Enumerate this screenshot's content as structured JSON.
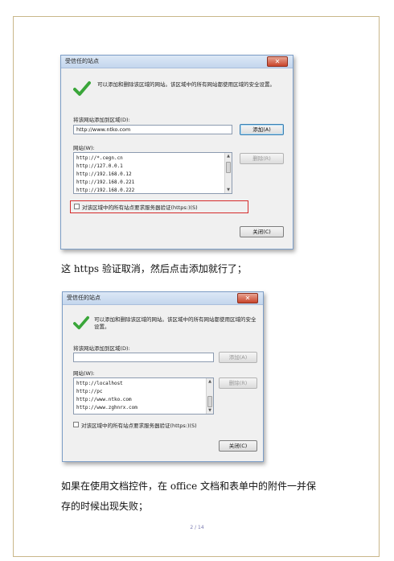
{
  "dialog1": {
    "title": "受信任的站点",
    "close": "✕",
    "description": "可以添加和删除该区域的网站。该区域中的所有网站都使用区域的安全设置。",
    "add_label": "将该网站添加到区域(D):",
    "add_value": "http://www.ntko.com",
    "add_button": "添加(A)",
    "sites_label": "网站(W):",
    "sites": [
      "http://*.cegn.cn",
      "http://127.0.0.1",
      "http://192.168.0.12",
      "http://192.168.0.221",
      "http://192.168.0.222"
    ],
    "remove_button": "删除(R)",
    "https_checkbox": "对该区域中的所有站点要求服务器验证(https:)(S)",
    "close_button": "关闭(C)"
  },
  "para1": "这 https 验证取消，然后点击添加就行了；",
  "dialog2": {
    "title": "受信任的站点",
    "close": "✕",
    "description": "可以添加和删除该区域的网站。该区域中的所有网站都使用区域的安全设置。",
    "add_label": "将该网站添加到区域(D):",
    "add_value": "",
    "add_button": "添加(A)",
    "sites_label": "网站(W):",
    "sites": [
      "http://localhost",
      "http://pc",
      "http://www.ntko.com",
      "http://www.zghnrx.com"
    ],
    "remove_button": "删除(R)",
    "https_checkbox": "对该区域中的所有站点要求服务器验证(https:)(S)",
    "close_button": "关闭(C)"
  },
  "para2_line1": "如果在使用文档控件，在 office 文档和表单中的附件一并保",
  "para2_line2": "存的时候出现失败；",
  "page_number": "2 / 14"
}
